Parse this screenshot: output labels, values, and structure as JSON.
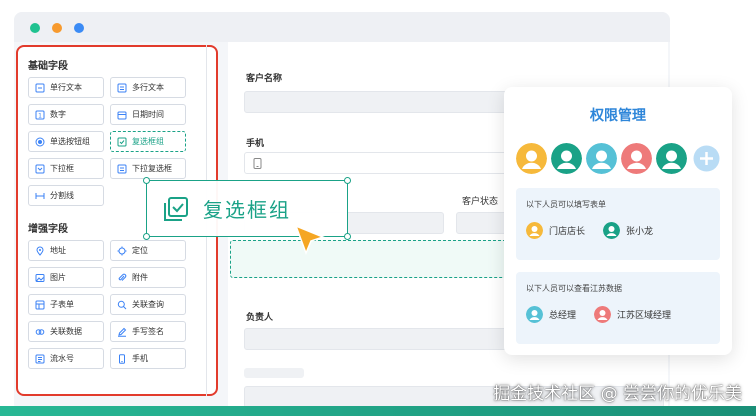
{
  "palette": {
    "basic_title": "基础字段",
    "basic_fields": [
      {
        "label": "单行文本",
        "icon": "single-line-text-icon"
      },
      {
        "label": "多行文本",
        "icon": "multi-line-text-icon"
      },
      {
        "label": "数字",
        "icon": "number-icon"
      },
      {
        "label": "日期时间",
        "icon": "datetime-icon"
      },
      {
        "label": "单选按钮组",
        "icon": "radio-icon"
      },
      {
        "label": "复选框组",
        "icon": "checkbox-icon"
      },
      {
        "label": "下拉框",
        "icon": "dropdown-icon"
      },
      {
        "label": "下拉复选框",
        "icon": "dropdown-checkbox-icon"
      },
      {
        "label": "分割线",
        "icon": "divider-icon"
      }
    ],
    "advanced_title": "增强字段",
    "advanced_fields": [
      {
        "label": "地址",
        "icon": "location-pin-icon"
      },
      {
        "label": "定位",
        "icon": "crosshair-icon"
      },
      {
        "label": "图片",
        "icon": "image-icon"
      },
      {
        "label": "附件",
        "icon": "paperclip-icon"
      },
      {
        "label": "子表单",
        "icon": "subform-icon"
      },
      {
        "label": "关联查询",
        "icon": "search-icon"
      },
      {
        "label": "关联数据",
        "icon": "link-data-icon"
      },
      {
        "label": "手写签名",
        "icon": "pen-icon"
      },
      {
        "label": "流水号",
        "icon": "serial-number-icon"
      },
      {
        "label": "手机",
        "icon": "phone-icon"
      }
    ]
  },
  "form": {
    "customer_name_label": "客户名称",
    "phone_label": "手机",
    "customer_status_label": "客户状态",
    "owner_label": "负责人"
  },
  "drag_item": {
    "label": "复选框组",
    "icon": "checkbox-icon"
  },
  "permission": {
    "title": "权限管理",
    "fill_text": "以下人员可以填写表单",
    "fill_people": [
      {
        "name": "门店店长"
      },
      {
        "name": "张小龙"
      }
    ],
    "view_text": "以下人员可以查看江苏数据",
    "view_people": [
      {
        "name": "总经理"
      },
      {
        "name": "江苏区域经理"
      }
    ]
  },
  "watermark": "掘金技术社区 @ 尝尝你的优乐美",
  "colors": {
    "accent": "#1aa287",
    "highlight_border": "#e23b2c",
    "title_blue": "#2e86d9"
  }
}
